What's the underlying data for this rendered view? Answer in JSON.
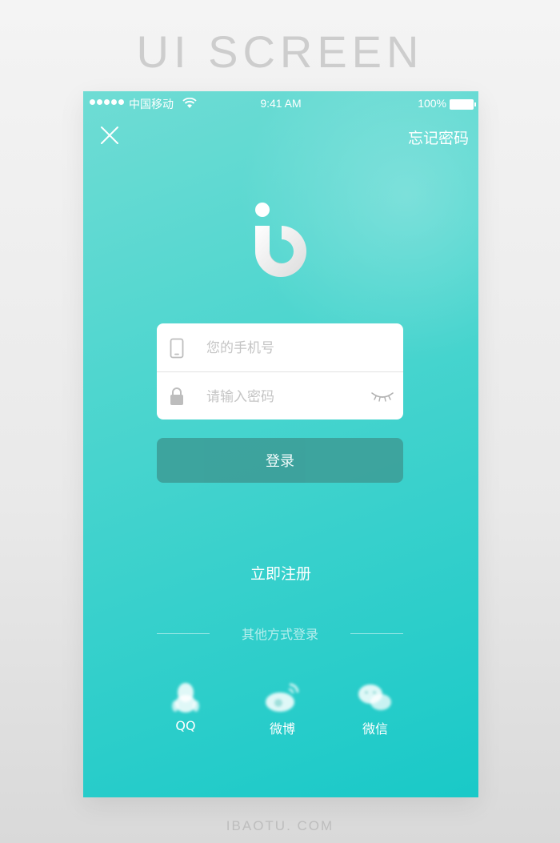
{
  "showcase": {
    "title": "UI SCREEN",
    "footer": "IBAOTU. COM"
  },
  "status_bar": {
    "carrier": "中国移动",
    "time": "9:41 AM",
    "battery": "100%"
  },
  "header": {
    "forgot_password": "忘记密码"
  },
  "form": {
    "phone_placeholder": "您的手机号",
    "password_placeholder": "请输入密码"
  },
  "login_button": "登录",
  "register_link": "立即注册",
  "other_login": {
    "label": "其他方式登录",
    "options": [
      {
        "label": "QQ",
        "icon": "qq-penguin-icon"
      },
      {
        "label": "微博",
        "icon": "weibo-icon"
      },
      {
        "label": "微信",
        "icon": "wechat-icon"
      }
    ]
  },
  "colors": {
    "gradient_top": "#6fdcd4",
    "gradient_bottom": "#19c9c8",
    "login_button": "#3d9f9a"
  }
}
